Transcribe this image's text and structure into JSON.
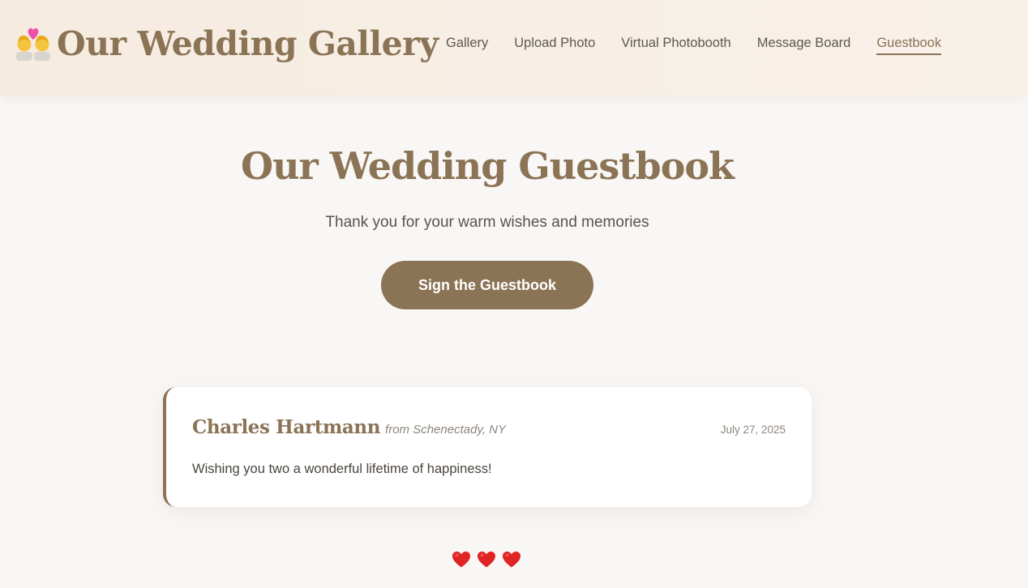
{
  "header": {
    "brand_title": "Our Wedding Gallery",
    "brand_icon": "couple-with-heart-icon",
    "nav": [
      {
        "label": "Gallery",
        "active": false
      },
      {
        "label": "Upload Photo",
        "active": false
      },
      {
        "label": "Virtual Photobooth",
        "active": false
      },
      {
        "label": "Message Board",
        "active": false
      },
      {
        "label": "Guestbook",
        "active": true
      }
    ]
  },
  "hero": {
    "title": "Our Wedding Guestbook",
    "subtitle": "Thank you for your warm wishes and memories",
    "cta_label": "Sign the Guestbook"
  },
  "entries": [
    {
      "name": "Charles Hartmann",
      "location": "from Schenectady, NY",
      "date": "July 27, 2025",
      "message": "Wishing you two a wonderful lifetime of happiness!"
    }
  ],
  "footer": {
    "hearts": [
      "heart-icon",
      "heart-icon",
      "heart-icon"
    ]
  },
  "colors": {
    "accent": "#8b7355",
    "background": "#f9f7f5",
    "header_background": "#f6ebdf",
    "card_background": "#ffffff",
    "heart": "#e02424"
  }
}
